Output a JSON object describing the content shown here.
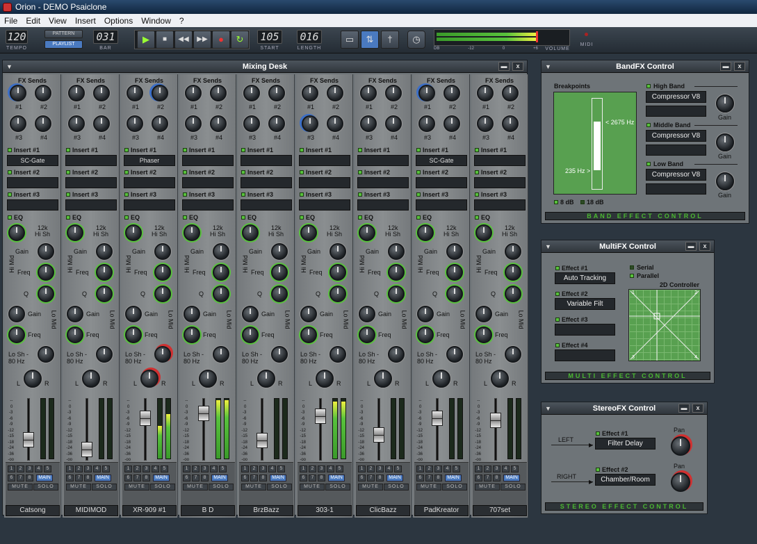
{
  "window": {
    "title": "Orion - DEMO Psaiclone"
  },
  "menu": [
    "File",
    "Edit",
    "View",
    "Insert",
    "Options",
    "Window",
    "?"
  ],
  "toolbar": {
    "tempo": "120",
    "tempo_label": "TEMPO",
    "pattern": "PATTERN",
    "playlist": "PLAYLIST",
    "bar": "031",
    "bar_label": "BAR",
    "start": "105",
    "start_label": "START",
    "length": "016",
    "length_label": "LENGTH",
    "vu_scale": [
      "DB",
      "-12",
      "0",
      "+6"
    ],
    "volume_label": "VOLUME",
    "midi_label": "MIDI"
  },
  "mixer": {
    "title": "Mixing Desk",
    "fx_sends": "FX Sends",
    "send_labels": [
      "#1",
      "#2",
      "#3",
      "#4"
    ],
    "insert_labels": [
      "Insert #1",
      "Insert #2",
      "Insert #3"
    ],
    "eq": "EQ",
    "hi_sh": "Hi Sh",
    "khz12": "12k",
    "gain": "Gain",
    "freq": "Freq",
    "q": "Q",
    "hi_mid": "Hi Mid",
    "lo_mid": "Lo Mid",
    "lo_sh": "Lo Sh -",
    "hz80": "80 Hz",
    "l": "L",
    "r": "R",
    "scale": "-- \n 0 \n-3 \n-6 \n-9 \n-12\n-15\n-18\n-24\n-36\n-oo",
    "nums": [
      "1",
      "2",
      "3",
      "4",
      "5",
      "6",
      "7",
      "8"
    ],
    "main": "MAIN",
    "mute": "MUTE",
    "solo": "SOLO",
    "channels": [
      {
        "name": "Catsong",
        "insert1": "SC-Gate"
      },
      {
        "name": "MIDIMOD",
        "insert1": ""
      },
      {
        "name": "XR-909 #1",
        "insert1": "Phaser"
      },
      {
        "name": "B D",
        "insert1": ""
      },
      {
        "name": "BrzBazz",
        "insert1": ""
      },
      {
        "name": "303-1",
        "insert1": ""
      },
      {
        "name": "ClicBazz",
        "insert1": ""
      },
      {
        "name": "PadKreator",
        "insert1": "SC-Gate"
      },
      {
        "name": "707set",
        "insert1": ""
      }
    ],
    "fader_levels": [
      0.3,
      0.1,
      0.75,
      0.85,
      0.28,
      0.78,
      0.4,
      0.75,
      0.7
    ],
    "meter_levels": [
      [
        0,
        0
      ],
      [
        0,
        0
      ],
      [
        0.55,
        0.75
      ],
      [
        0.98,
        0.98
      ],
      [
        0,
        0
      ],
      [
        0.95,
        0.95
      ],
      [
        0,
        0
      ],
      [
        0,
        0
      ],
      [
        0,
        0
      ]
    ]
  },
  "bandfx": {
    "title": "BandFX Control",
    "breakpoints": "Breakpoints",
    "upper": "< 2675 Hz",
    "lower": "235 Hz >",
    "db8": "8 dB",
    "db18": "18 dB",
    "high_band": "High Band",
    "middle_band": "Middle Band",
    "low_band": "Low Band",
    "plugin": "Compressor V8",
    "gain": "Gain",
    "footer": "BAND EFFECT CONTROL"
  },
  "multifx": {
    "title": "MultiFX Control",
    "effect1": "Effect #1",
    "effect1_value": "Auto Tracking",
    "effect2": "Effect #2",
    "effect2_value": "Variable Filt",
    "effect3": "Effect #3",
    "effect4": "Effect #4",
    "serial": "Serial",
    "parallel": "Parallel",
    "controller": "2D Controller",
    "c1": "1",
    "c2": "2",
    "c3": "3",
    "c4": "4",
    "footer": "MULTI EFFECT CONTROL"
  },
  "stereofx": {
    "title": "StereoFX Control",
    "left": "LEFT",
    "right": "RIGHT",
    "effect1": "Effect #1",
    "effect1_value": "Filter Delay",
    "effect2": "Effect #2",
    "effect2_value": "Chamber/Room",
    "pan": "Pan",
    "footer": "STEREO EFFECT CONTROL"
  }
}
